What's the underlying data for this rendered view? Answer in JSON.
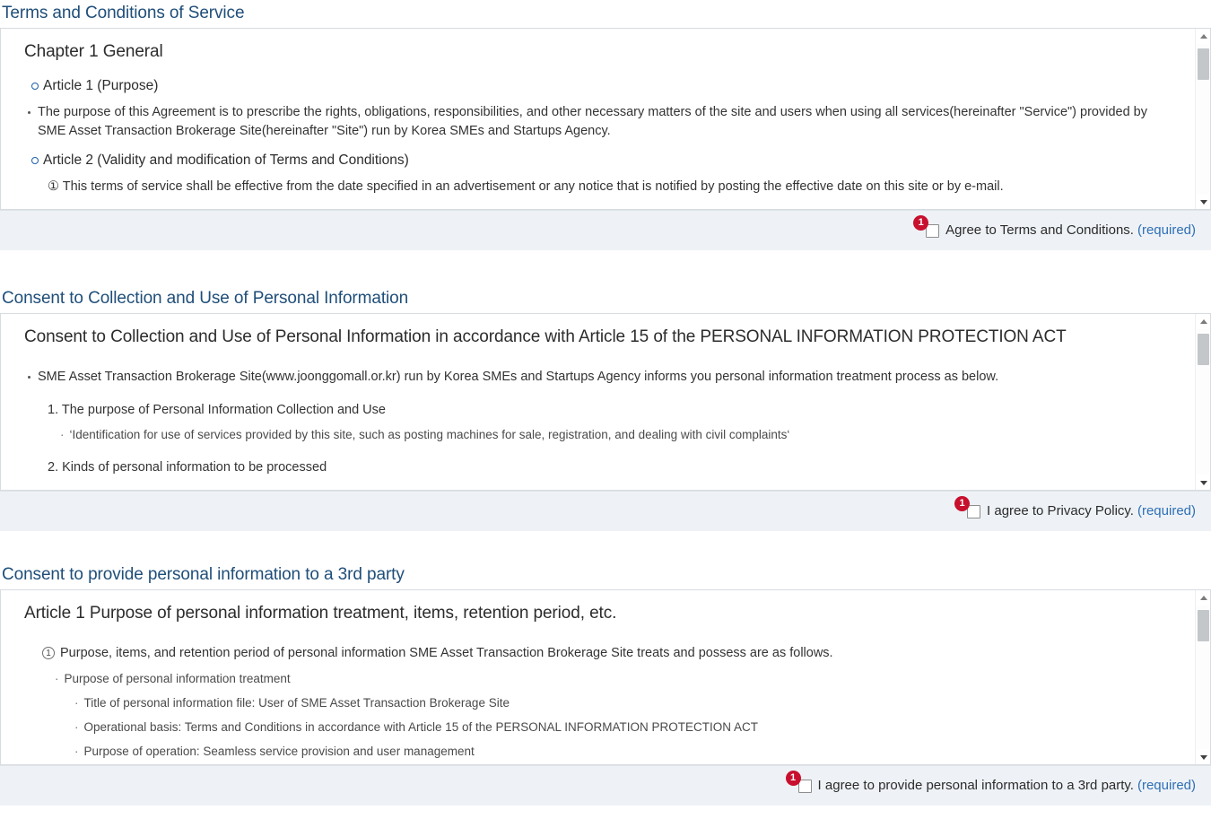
{
  "colors": {
    "heading": "#1f4e79",
    "badge": "#c8102e",
    "link": "#2f6fb5",
    "footer_bg": "#eef2f6",
    "panel_border": "#d7dce1"
  },
  "sections": [
    {
      "title": "Terms and Conditions of Service",
      "doc_heading": "Chapter 1 General",
      "articles": [
        {
          "label": "Article 1 (Purpose)",
          "bullets": [
            "The purpose of this Agreement is to prescribe the rights, obligations, responsibilities, and other necessary matters of the site and users when using all services(hereinafter \"Service\") provided by SME Asset Transaction Brokerage Site(hereinafter \"Site\") run by Korea SMEs and Startups Agency."
          ]
        },
        {
          "label": "Article 2 (Validity and modification of Terms and Conditions)",
          "clipped": "① This terms of service shall be effective from the date specified in an advertisement or any notice that is notified by posting the effective date on this site or by e-mail."
        }
      ],
      "agree": {
        "badge": "1",
        "label": "Agree to Terms and Conditions.",
        "required": "(required)",
        "checked": false
      }
    },
    {
      "title": "Consent to Collection and Use of Personal Information",
      "doc_heading": "Consent to Collection and Use of Personal Information in accordance with Article 15 of the PERSONAL INFORMATION PROTECTION ACT",
      "intro_bullet": "SME Asset Transaction Brokerage Site(www.joonggomall.or.kr) run by Korea SMEs and Startups Agency informs you personal information treatment process as below.",
      "items": [
        {
          "number": "1. The purpose of Personal Information Collection and Use",
          "sub": "‘Identification for use of services provided by this site, such as posting machines for sale, registration, and dealing with civil complaints‘"
        },
        {
          "number": "2. Kinds of personal information to be processed",
          "sub": ""
        }
      ],
      "agree": {
        "badge": "1",
        "label": "I agree to Privacy Policy.",
        "required": "(required)",
        "checked": false
      }
    },
    {
      "title": "Consent to provide personal information to a 3rd party",
      "doc_heading": "Article 1 Purpose of personal information treatment, items, retention period, etc.",
      "circled": "Purpose, items, and retention period of personal information SME Asset Transaction Brokerage Site treats and possess are as follows.",
      "mid_item": "Purpose of personal information treatment",
      "deep_items": [
        "Title of personal information file: User of SME Asset Transaction Brokerage Site",
        "Operational basis: Terms and Conditions in accordance with Article 15 of the PERSONAL INFORMATION PROTECTION ACT",
        "Purpose of operation: Seamless service provision and user management"
      ],
      "agree": {
        "badge": "1",
        "label": "I agree to provide personal information to a 3rd party.",
        "required": "(required)",
        "checked": false
      }
    }
  ]
}
